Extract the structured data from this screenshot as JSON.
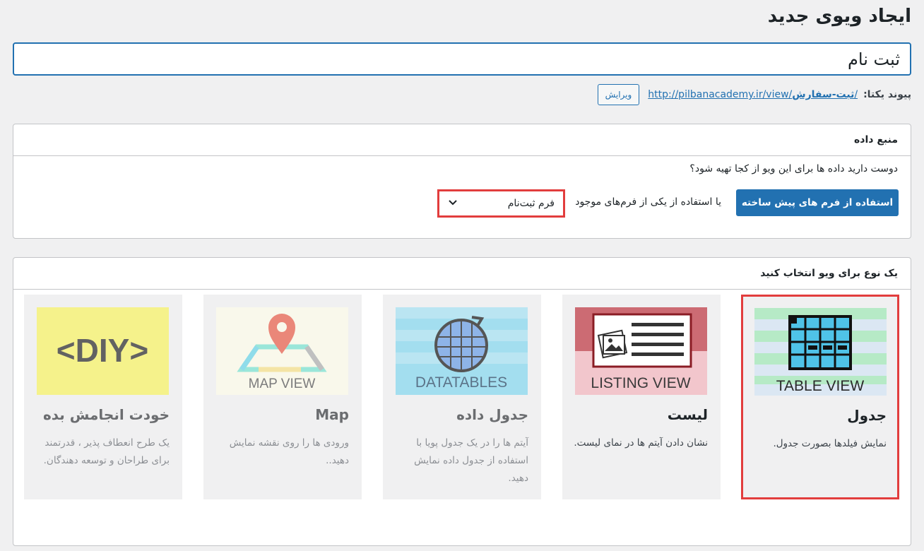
{
  "page": {
    "title": "ایجاد ویوی جدید",
    "view_name": "ثبت نام"
  },
  "permalink": {
    "label": "پیوند یکتا:",
    "url_base": "http://pilbanacademy.ir/view/",
    "slug": "ثبت-سفارش",
    "trailing": "/",
    "edit_label": "ویرایش"
  },
  "data_source": {
    "header": "منبع داده",
    "question": "دوست دارید داده ها برای این ویو از کجا تهیه شود؟",
    "prebuilt_button": "استفاده از فرم های پیش ساخته",
    "or_text": "یا استفاده از یکی از فرم‌های موجود",
    "selected_form": "فرم ثبت‌نام"
  },
  "view_type": {
    "header": "یک نوع برای ویو انتخاب کنید",
    "cards": [
      {
        "id": "table",
        "title": "جدول",
        "description": "نمایش فیلدها بصورت جدول.",
        "image_caption": "TABLE VIEW",
        "selected": true
      },
      {
        "id": "list",
        "title": "لیست",
        "description": "نشان دادن آیتم ها در نمای لیست.",
        "image_caption": "LISTING VIEW",
        "selected": false
      },
      {
        "id": "datatables",
        "title": "جدول داده",
        "description": "آیتم ها را در یک جدول پویا با استفاده از جدول داده نمایش دهید.",
        "image_caption": "DATATABLES",
        "selected": false
      },
      {
        "id": "map",
        "title": "Map",
        "description": "ورودی ها را روی نقشه نمایش دهید..",
        "image_caption": "MAP VIEW",
        "selected": false
      },
      {
        "id": "diy",
        "title": "خودت انجامش بده",
        "description": "یک طرح انعطاف پذیر ، قدرتمند برای طراحان و توسعه دهندگان.",
        "image_caption": "<DIY>",
        "selected": false
      }
    ]
  },
  "colors": {
    "primary": "#2271b1",
    "highlight": "#e23d3d",
    "background": "#f0f0f1"
  }
}
